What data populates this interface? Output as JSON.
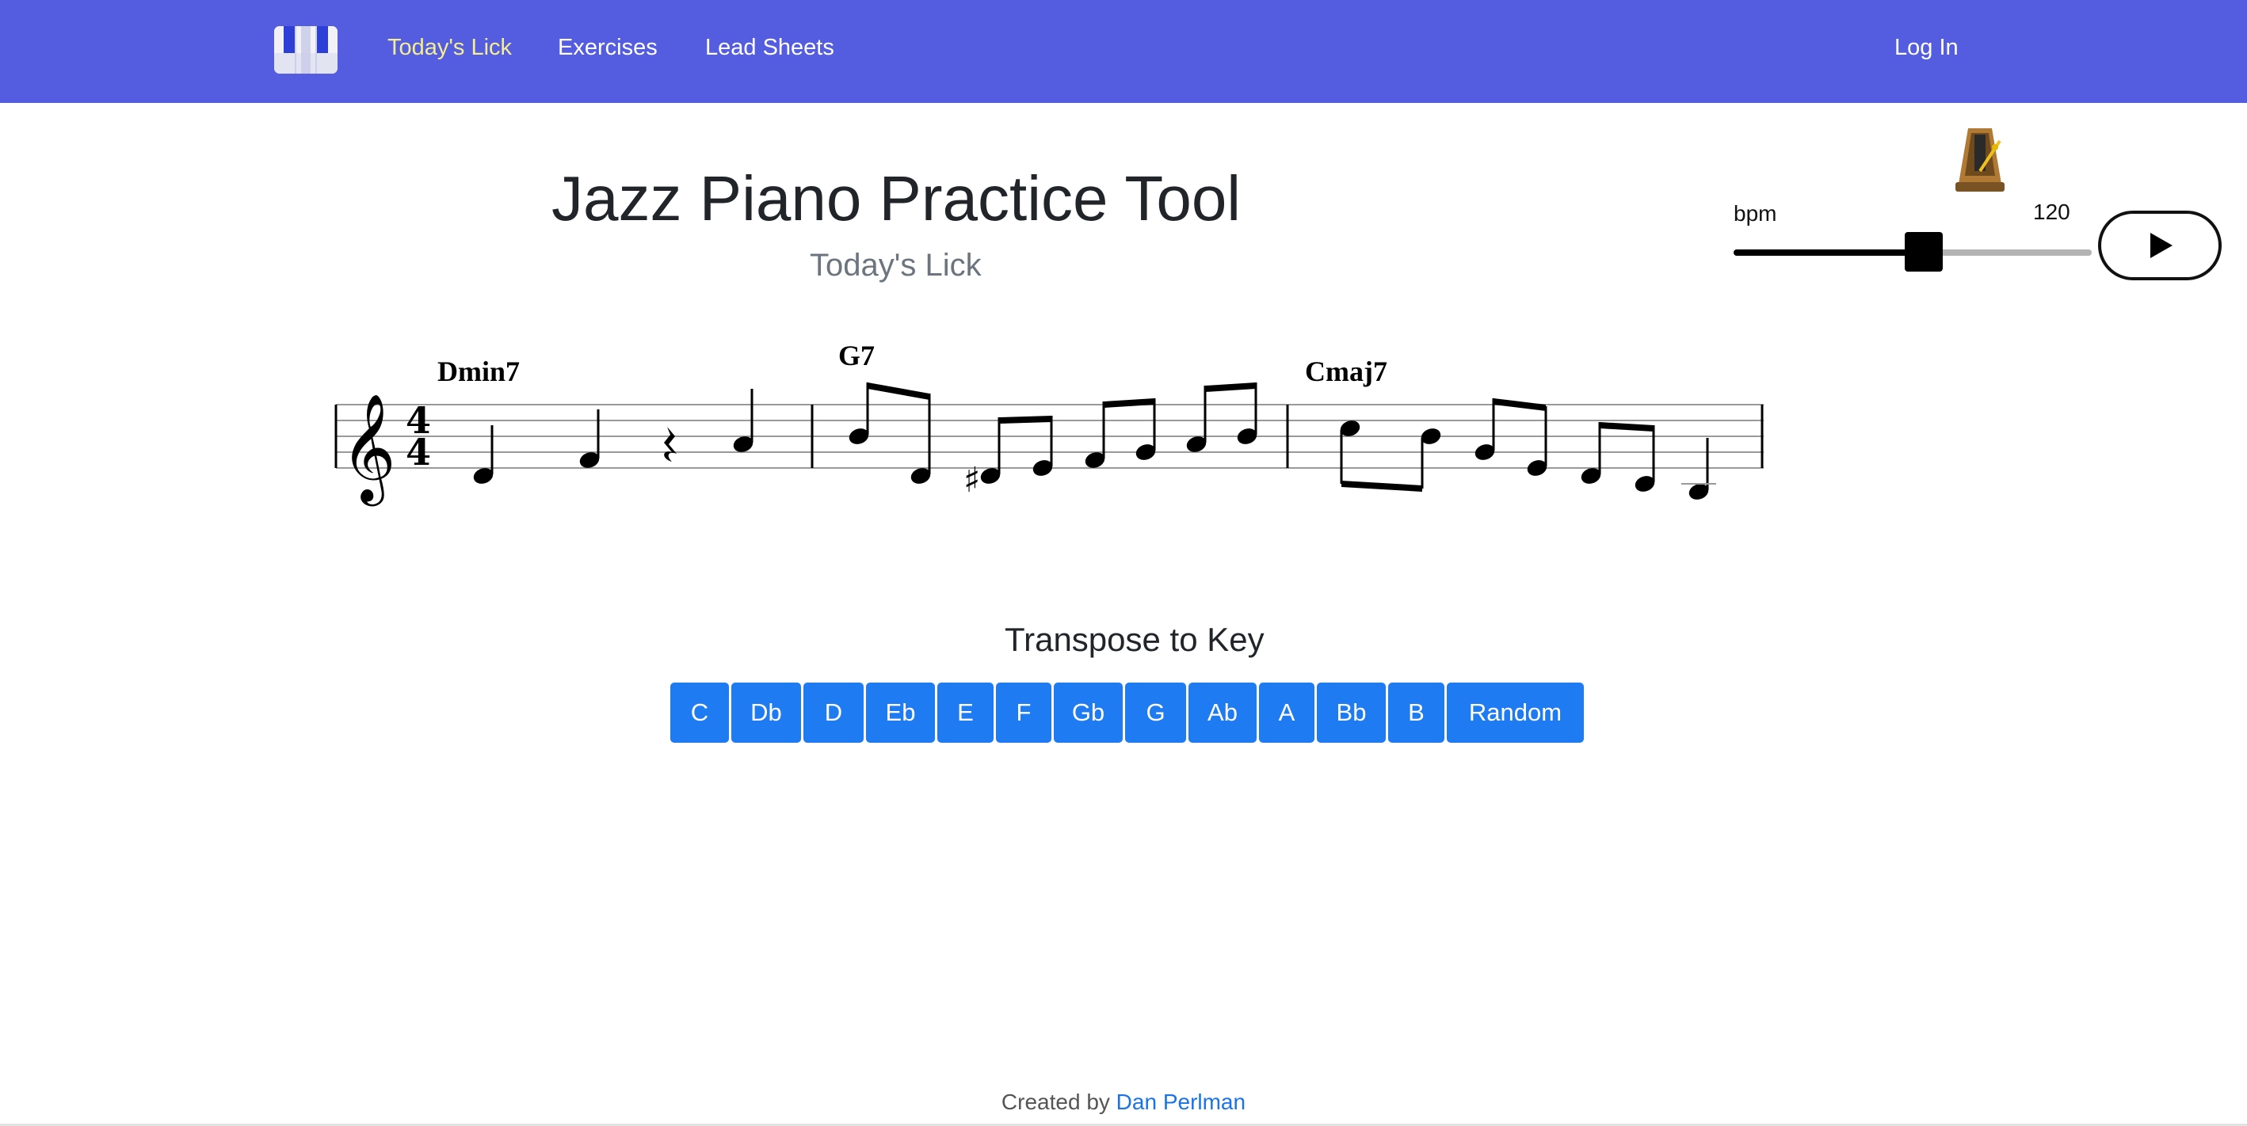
{
  "nav": {
    "brand_icon": "piano-keys-icon",
    "links": [
      "Today's Lick",
      "Exercises",
      "Lead Sheets"
    ],
    "active_link": "Today's Lick",
    "login": "Log In",
    "bar_color": "#545ce0",
    "active_color": "#f4ee8f"
  },
  "header": {
    "title": "Jazz Piano Practice Tool",
    "subtitle": "Today's Lick"
  },
  "metronome": {
    "icon": "metronome-icon",
    "bpm_label": "bpm",
    "bpm_value": "120",
    "slider_fraction": 0.53,
    "play_icon": "play-icon"
  },
  "score": {
    "clef": "treble",
    "time_signature": "4/4",
    "chords": [
      "Dmin7",
      "G7",
      "Cmaj7"
    ]
  },
  "transpose": {
    "heading": "Transpose to Key",
    "keys": [
      "C",
      "Db",
      "D",
      "Eb",
      "E",
      "F",
      "Gb",
      "G",
      "Ab",
      "A",
      "Bb",
      "B",
      "Random"
    ],
    "button_color": "#1f7bf2"
  },
  "footer": {
    "prefix": "Created by",
    "author": "Dan Perlman"
  }
}
